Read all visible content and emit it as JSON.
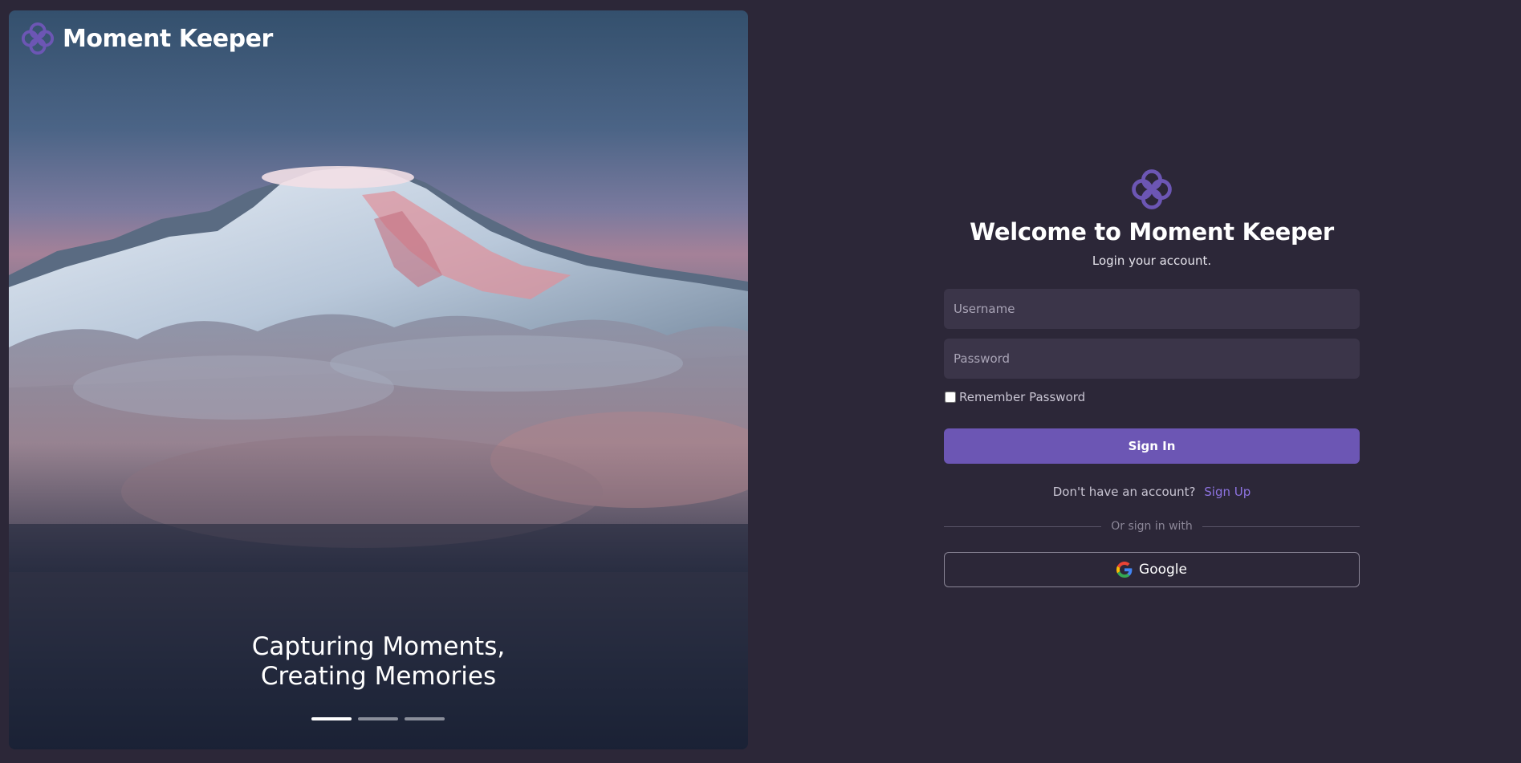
{
  "brand": {
    "name": "Moment Keeper",
    "accent": "#6c56b4"
  },
  "hero": {
    "tagline_line1": "Capturing Moments,",
    "tagline_line2": "Creating Memories",
    "carousel": {
      "total": 3,
      "active_index": 1
    }
  },
  "login": {
    "title": "Welcome to Moment Keeper",
    "subtitle": "Login your account.",
    "username_placeholder": "Username",
    "password_placeholder": "Password",
    "remember_label": "Remember Password",
    "remember_checked": false,
    "signin_label": "Sign In",
    "no_account_text": "Don't have an account?",
    "signup_link": "Sign Up",
    "divider_text": "Or sign in with",
    "google_label": "Google"
  },
  "icons": {
    "logo": "flower-logo-icon",
    "google": "google-g-icon"
  }
}
